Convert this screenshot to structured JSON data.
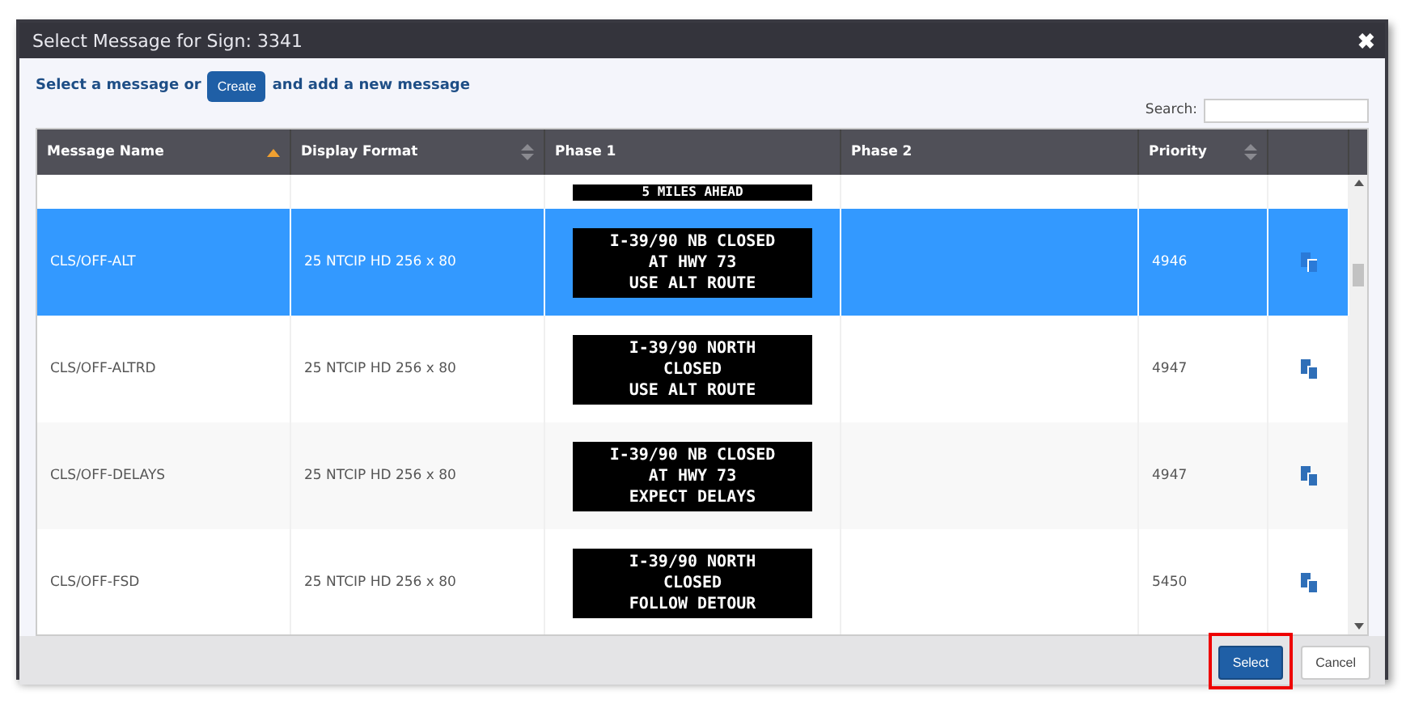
{
  "window": {
    "title": "Select Message for Sign: 3341",
    "close": "✖"
  },
  "intro": {
    "before": "Select a message or",
    "button": "Create",
    "after": "and add a new message"
  },
  "search": {
    "label": "Search:"
  },
  "table": {
    "columns": [
      {
        "label": "Message Name",
        "kind": "sorted"
      },
      {
        "label": "Display Format",
        "kind": "sortable"
      },
      {
        "label": "Phase 1",
        "kind": "plain"
      },
      {
        "label": "Phase 2",
        "kind": "plain"
      },
      {
        "label": "Priority",
        "kind": "sortable"
      },
      {
        "kind": "plain"
      }
    ],
    "rows": [
      {
        "phase1": [
          "5 MILES AHEAD"
        ],
        "selected": false,
        "partial": true
      },
      {
        "name": "CLS/OFF-ALT",
        "format": "25 NTCIP HD 256 x 80",
        "phase1": [
          "I-39/90 NB CLOSED",
          "AT HWY 73",
          "USE ALT ROUTE"
        ],
        "priority": "4946",
        "selected": true,
        "partial": false
      },
      {
        "name": "CLS/OFF-ALTRD",
        "format": "25 NTCIP HD 256 x 80",
        "phase1": [
          "I-39/90 NORTH",
          "CLOSED",
          "USE ALT ROUTE"
        ],
        "priority": "4947",
        "selected": false,
        "partial": false
      },
      {
        "name": "CLS/OFF-DELAYS",
        "format": "25 NTCIP HD 256 x 80",
        "phase1": [
          "I-39/90 NB CLOSED",
          "AT HWY 73",
          "EXPECT DELAYS"
        ],
        "priority": "4947",
        "selected": false,
        "partial": false
      },
      {
        "name": "CLS/OFF-FSD",
        "format": "25 NTCIP HD 256 x 80",
        "phase1": [
          "I-39/90 NORTH",
          "CLOSED",
          "FOLLOW DETOUR"
        ],
        "priority": "5450",
        "selected": false,
        "partial": false
      }
    ]
  },
  "buttons": [
    {
      "label": "Select",
      "kind": "primary",
      "highlighted": true
    },
    {
      "label": "Cancel",
      "kind": "secondary",
      "highlighted": false
    }
  ]
}
